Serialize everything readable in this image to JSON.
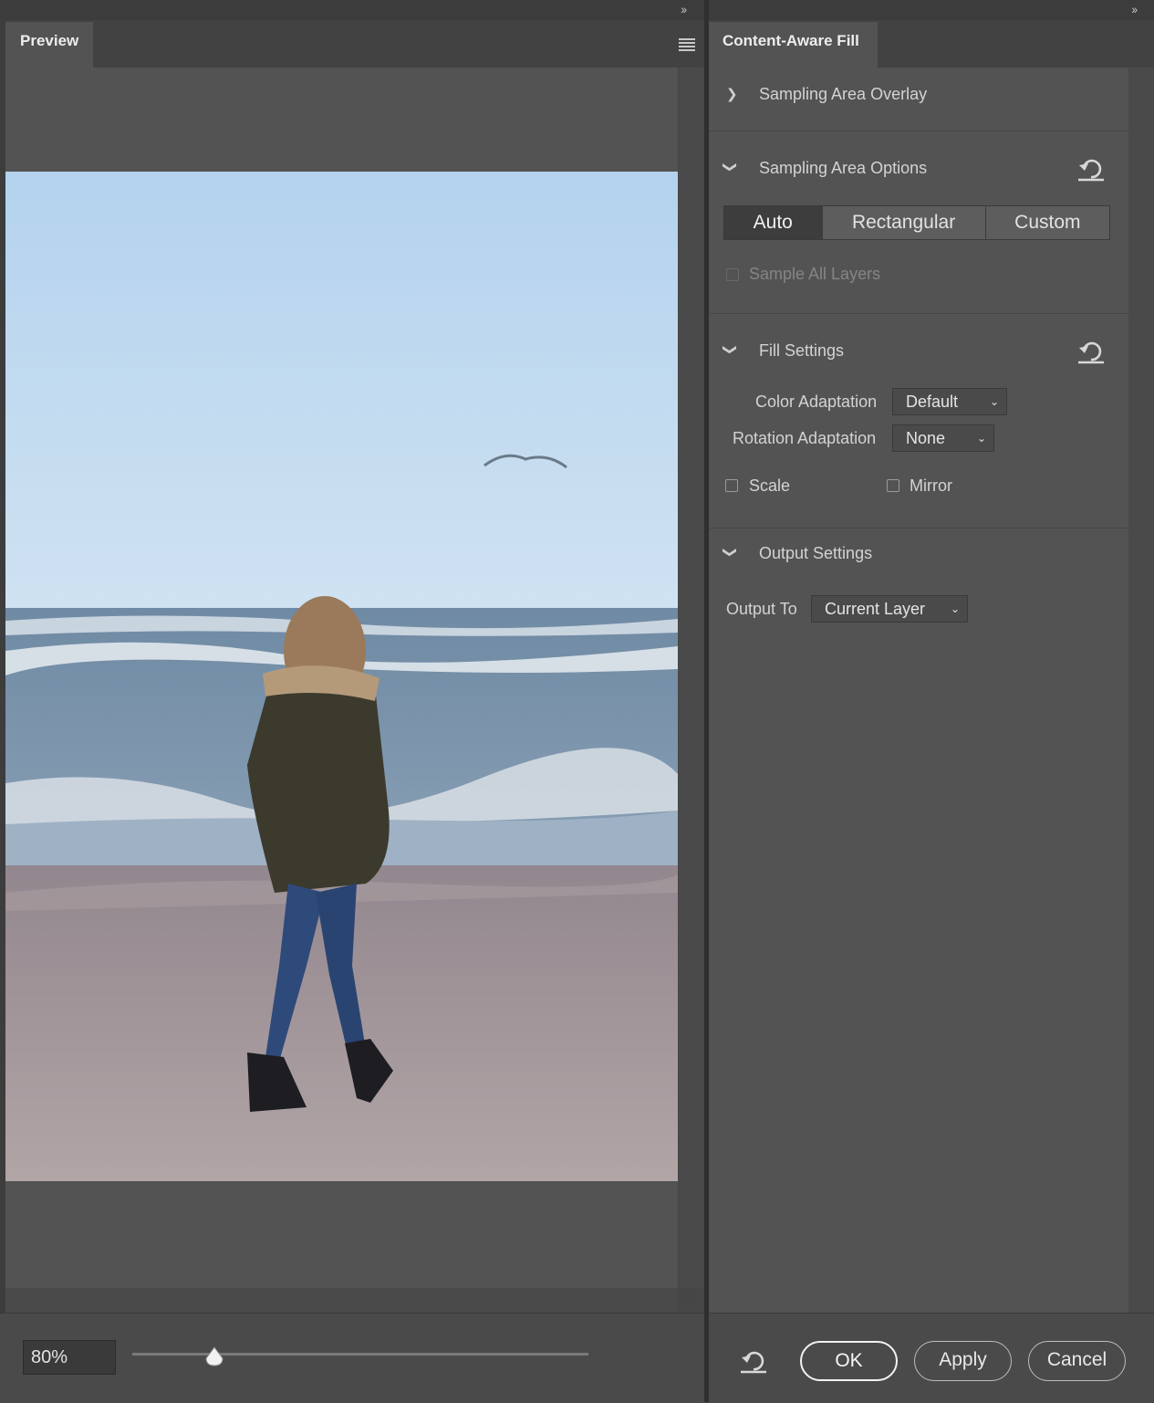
{
  "left_panel": {
    "tab": "Preview",
    "zoom": "80%",
    "zoom_slider_fraction": 0.18
  },
  "right_panel": {
    "tab": "Content-Aware Fill",
    "sampling_area_overlay": {
      "title": "Sampling Area Overlay"
    },
    "sampling_area_options": {
      "title": "Sampling Area Options",
      "modes": [
        "Auto",
        "Rectangular",
        "Custom"
      ],
      "selected_mode": "Auto",
      "sample_all_layers": "Sample All Layers"
    },
    "fill_settings": {
      "title": "Fill Settings",
      "color_adaptation_label": "Color Adaptation",
      "color_adaptation_value": "Default",
      "rotation_adaptation_label": "Rotation Adaptation",
      "rotation_adaptation_value": "None",
      "scale_label": "Scale",
      "mirror_label": "Mirror"
    },
    "output_settings": {
      "title": "Output Settings",
      "output_to_label": "Output To",
      "output_to_value": "Current Layer"
    }
  },
  "buttons": {
    "ok": "OK",
    "apply": "Apply",
    "cancel": "Cancel"
  },
  "icons": {
    "collapse": "double-chevron-right-icon",
    "panel_menu": "hamburger-menu-icon",
    "reset": "reset-arrow-icon"
  }
}
